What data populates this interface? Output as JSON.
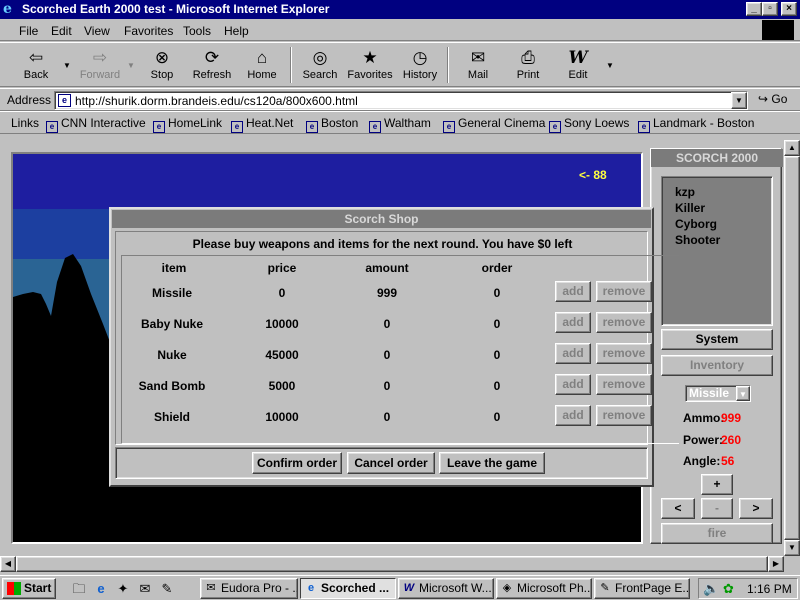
{
  "window": {
    "title": "Scorched Earth 2000 test - Microsoft Internet Explorer"
  },
  "menu": [
    "File",
    "Edit",
    "View",
    "Favorites",
    "Tools",
    "Help"
  ],
  "toolbar": {
    "back": "Back",
    "forward": "Forward",
    "stop": "Stop",
    "refresh": "Refresh",
    "home": "Home",
    "search": "Search",
    "favorites": "Favorites",
    "history": "History",
    "mail": "Mail",
    "print": "Print",
    "edit": "Edit"
  },
  "address": {
    "label": "Address",
    "url": "http://shurik.dorm.brandeis.edu/cs120a/800x600.html",
    "go": "Go"
  },
  "links": {
    "label": "Links",
    "items": [
      "CNN Interactive",
      "HomeLink",
      "Heat.Net",
      "Boston",
      "Waltham",
      "General Cinema",
      "Sony Loews",
      "Landmark - Boston"
    ]
  },
  "game": {
    "arrow_readout": "<- 88"
  },
  "side": {
    "title": "SCORCH 2000",
    "players": [
      "kzp",
      "Killer",
      "Cyborg",
      "Shooter"
    ],
    "system": "System",
    "inventory": "Inventory",
    "weapon": "Missile",
    "stats": [
      {
        "label": "Ammo:",
        "value": "999"
      },
      {
        "label": "Power:",
        "value": "260"
      },
      {
        "label": "Angle:",
        "value": "56"
      }
    ],
    "plus": "+",
    "minus": "-",
    "left": "<",
    "right": ">",
    "fire": "fire"
  },
  "shop": {
    "title": "Scorch Shop",
    "message": "Please buy weapons and items for the next round. You have $0 left",
    "columns": {
      "item": "item",
      "price": "price",
      "amount": "amount",
      "order": "order"
    },
    "rows": [
      {
        "item": "Missile",
        "price": "0",
        "amount": "999",
        "order": "0"
      },
      {
        "item": "Baby Nuke",
        "price": "10000",
        "amount": "0",
        "order": "0"
      },
      {
        "item": "Nuke",
        "price": "45000",
        "amount": "0",
        "order": "0"
      },
      {
        "item": "Sand Bomb",
        "price": "5000",
        "amount": "0",
        "order": "0"
      },
      {
        "item": "Shield",
        "price": "10000",
        "amount": "0",
        "order": "0"
      }
    ],
    "add": "add",
    "remove": "remove",
    "confirm": "Confirm order",
    "cancel": "Cancel order",
    "leave": "Leave the game"
  },
  "taskbar": {
    "start": "Start",
    "tasks": [
      "Eudora Pro - ...",
      "Scorched ...",
      "Microsoft W...",
      "Microsoft Ph...",
      "FrontPage E..."
    ],
    "clock": "1:16 PM"
  },
  "colors": {
    "titlebar": "#000080",
    "sky_top": "#1e1ea0",
    "sky_mid": "#1c3fa0",
    "sky_low": "#2a6494",
    "mountain": "#000000",
    "stat_value": "#ff0000",
    "arrow_readout": "#ffff40"
  }
}
